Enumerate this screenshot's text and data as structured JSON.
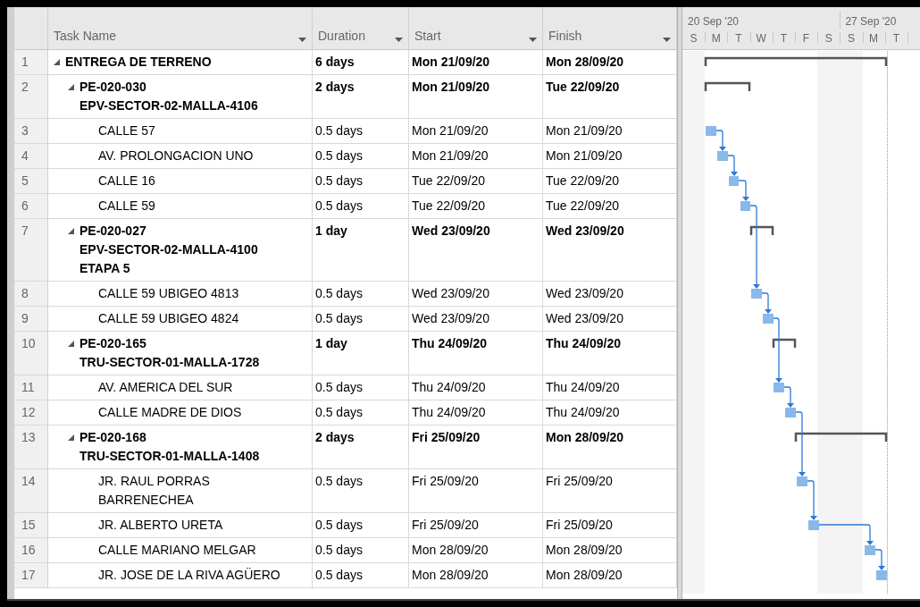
{
  "table": {
    "columns": [
      {
        "label": "Task Name"
      },
      {
        "label": "Duration"
      },
      {
        "label": "Start"
      },
      {
        "label": "Finish"
      }
    ],
    "rows": [
      {
        "id": "1",
        "name": "ENTREGA DE TERRENO",
        "duration": "6 days",
        "start": "Mon 21/09/20",
        "finish": "Mon 28/09/20",
        "kind": "summary",
        "expanded": true,
        "children": [
          {
            "id": "2",
            "name": "PE-020-030 EPV-SECTOR-02-MALLA-4106",
            "duration": "2 days",
            "start": "Mon 21/09/20",
            "finish": "Tue 22/09/20",
            "kind": "summary",
            "expanded": true,
            "children": [
              {
                "id": "3",
                "name": "CALLE 57",
                "duration": "0.5 days",
                "start": "Mon 21/09/20",
                "finish": "Mon 21/09/20",
                "kind": "task"
              },
              {
                "id": "4",
                "name": "AV. PROLONGACION UNO",
                "duration": "0.5 days",
                "start": "Mon 21/09/20",
                "finish": "Mon 21/09/20",
                "kind": "task"
              },
              {
                "id": "5",
                "name": "CALLE 16",
                "duration": "0.5 days",
                "start": "Tue 22/09/20",
                "finish": "Tue 22/09/20",
                "kind": "task"
              },
              {
                "id": "6",
                "name": "CALLE 59",
                "duration": "0.5 days",
                "start": "Tue 22/09/20",
                "finish": "Tue 22/09/20",
                "kind": "task"
              }
            ]
          },
          {
            "id": "7",
            "name": "PE-020-027 EPV-SECTOR-02-MALLA-4100 ETAPA 5",
            "duration": "1 day",
            "start": "Wed 23/09/20",
            "finish": "Wed 23/09/20",
            "kind": "summary",
            "expanded": true,
            "children": [
              {
                "id": "8",
                "name": "CALLE 59 UBIGEO 4813",
                "duration": "0.5 days",
                "start": "Wed 23/09/20",
                "finish": "Wed 23/09/20",
                "kind": "task"
              },
              {
                "id": "9",
                "name": "CALLE 59 UBIGEO 4824",
                "duration": "0.5 days",
                "start": "Wed 23/09/20",
                "finish": "Wed 23/09/20",
                "kind": "task"
              }
            ]
          },
          {
            "id": "10",
            "name": "PE-020-165 TRU-SECTOR-01-MALLA-1728",
            "duration": "1 day",
            "start": "Thu 24/09/20",
            "finish": "Thu 24/09/20",
            "kind": "summary",
            "expanded": true,
            "children": [
              {
                "id": "11",
                "name": "AV. AMERICA DEL SUR",
                "duration": "0.5 days",
                "start": "Thu 24/09/20",
                "finish": "Thu 24/09/20",
                "kind": "task"
              },
              {
                "id": "12",
                "name": "CALLE MADRE DE DIOS",
                "duration": "0.5 days",
                "start": "Thu 24/09/20",
                "finish": "Thu 24/09/20",
                "kind": "task"
              }
            ]
          },
          {
            "id": "13",
            "name": "PE-020-168 TRU-SECTOR-01-MALLA-1408",
            "duration": "2 days",
            "start": "Fri 25/09/20",
            "finish": "Mon 28/09/20",
            "kind": "summary",
            "expanded": true,
            "children": [
              {
                "id": "14",
                "name": "JR. RAUL PORRAS BARRENECHEA",
                "duration": "0.5 days",
                "start": "Fri 25/09/20",
                "finish": "Fri 25/09/20",
                "kind": "task"
              },
              {
                "id": "15",
                "name": "JR. ALBERTO URETA",
                "duration": "0.5 days",
                "start": "Fri 25/09/20",
                "finish": "Fri 25/09/20",
                "kind": "task"
              },
              {
                "id": "16",
                "name": "CALLE MARIANO MELGAR",
                "duration": "0.5 days",
                "start": "Mon 28/09/20",
                "finish": "Mon 28/09/20",
                "kind": "task"
              },
              {
                "id": "17",
                "name": "JR. JOSE DE LA RIVA AGÜERO",
                "duration": "0.5 days",
                "start": "Mon 28/09/20",
                "finish": "Mon 28/09/20",
                "kind": "task"
              }
            ]
          }
        ]
      }
    ]
  },
  "gantt": {
    "weeks": [
      {
        "label": "20 Sep '20"
      },
      {
        "label": "27 Sep '20"
      }
    ],
    "days": [
      {
        "label": "S",
        "weekend": true
      },
      {
        "label": "M",
        "weekend": false
      },
      {
        "label": "T",
        "weekend": false
      },
      {
        "label": "W",
        "weekend": false
      },
      {
        "label": "T",
        "weekend": false
      },
      {
        "label": "F",
        "weekend": false
      },
      {
        "label": "S",
        "weekend": true
      },
      {
        "label": "S",
        "weekend": true
      },
      {
        "label": "M",
        "weekend": false
      },
      {
        "label": "T",
        "weekend": false
      }
    ]
  }
}
